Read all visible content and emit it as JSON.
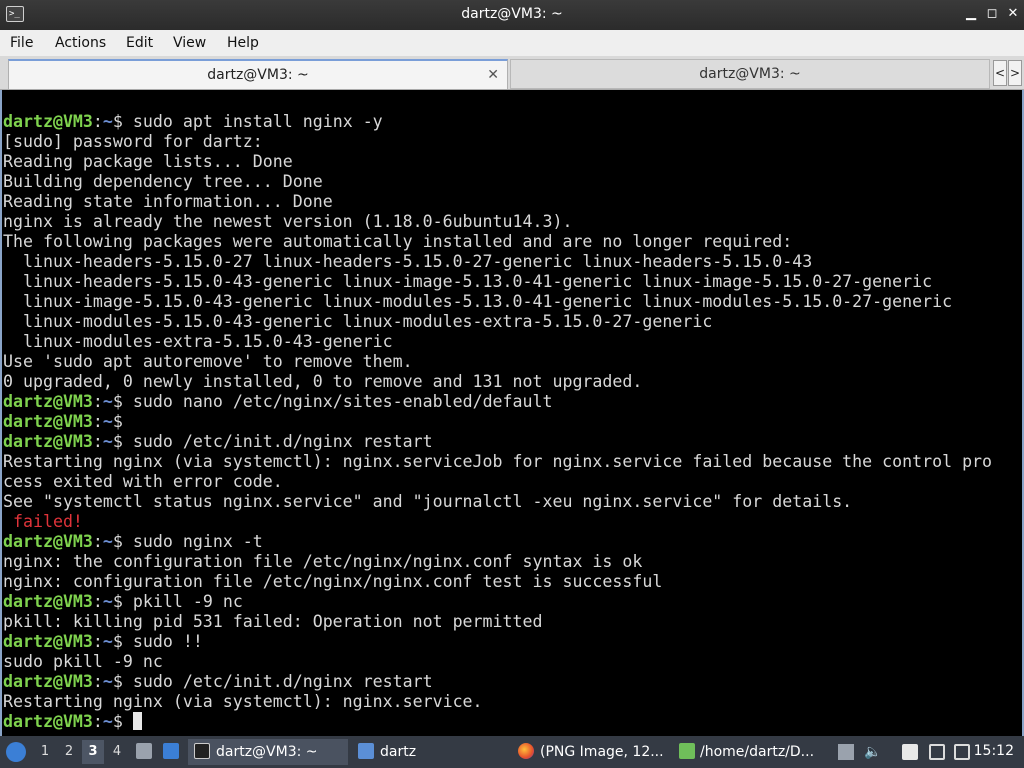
{
  "window": {
    "title": "dartz@VM3: ~",
    "minimize": "▁",
    "maximize": "◻",
    "close": "✕"
  },
  "menu": [
    "File",
    "Actions",
    "Edit",
    "View",
    "Help"
  ],
  "tabs": [
    {
      "label": "dartz@VM3: ~",
      "active": true
    },
    {
      "label": "dartz@VM3: ~",
      "active": false
    }
  ],
  "tab_nav": {
    "prev": "<",
    "next": ">"
  },
  "terminal": {
    "lines": [
      {
        "user": "dartz@VM3",
        "path": "~",
        "cmd": " sudo apt install nginx -y"
      },
      {
        "text": "[sudo] password for dartz:"
      },
      {
        "text": "Reading package lists... Done"
      },
      {
        "text": "Building dependency tree... Done"
      },
      {
        "text": "Reading state information... Done"
      },
      {
        "text": "nginx is already the newest version (1.18.0-6ubuntu14.3)."
      },
      {
        "text": "The following packages were automatically installed and are no longer required:"
      },
      {
        "text": "  linux-headers-5.15.0-27 linux-headers-5.15.0-27-generic linux-headers-5.15.0-43"
      },
      {
        "text": "  linux-headers-5.15.0-43-generic linux-image-5.13.0-41-generic linux-image-5.15.0-27-generic"
      },
      {
        "text": "  linux-image-5.15.0-43-generic linux-modules-5.13.0-41-generic linux-modules-5.15.0-27-generic"
      },
      {
        "text": "  linux-modules-5.15.0-43-generic linux-modules-extra-5.15.0-27-generic"
      },
      {
        "text": "  linux-modules-extra-5.15.0-43-generic"
      },
      {
        "text": "Use 'sudo apt autoremove' to remove them."
      },
      {
        "text": "0 upgraded, 0 newly installed, 0 to remove and 131 not upgraded."
      },
      {
        "user": "dartz@VM3",
        "path": "~",
        "cmd": " sudo nano /etc/nginx/sites-enabled/default"
      },
      {
        "user": "dartz@VM3",
        "path": "~",
        "cmd": ""
      },
      {
        "user": "dartz@VM3",
        "path": "~",
        "cmd": " sudo /etc/init.d/nginx restart"
      },
      {
        "text": "Restarting nginx (via systemctl): nginx.serviceJob for nginx.service failed because the control pro"
      },
      {
        "text": "cess exited with error code."
      },
      {
        "text": "See \"systemctl status nginx.service\" and \"journalctl -xeu nginx.service\" for details."
      },
      {
        "fail": " failed!"
      },
      {
        "user": "dartz@VM3",
        "path": "~",
        "cmd": " sudo nginx -t"
      },
      {
        "text": "nginx: the configuration file /etc/nginx/nginx.conf syntax is ok"
      },
      {
        "text": "nginx: configuration file /etc/nginx/nginx.conf test is successful"
      },
      {
        "user": "dartz@VM3",
        "path": "~",
        "cmd": " pkill -9 nc"
      },
      {
        "text": "pkill: killing pid 531 failed: Operation not permitted"
      },
      {
        "user": "dartz@VM3",
        "path": "~",
        "cmd": " sudo !!"
      },
      {
        "text": "sudo pkill -9 nc"
      },
      {
        "user": "dartz@VM3",
        "path": "~",
        "cmd": " sudo /etc/init.d/nginx restart"
      },
      {
        "text": "Restarting nginx (via systemctl): nginx.service."
      },
      {
        "user": "dartz@VM3",
        "path": "~",
        "cmd": " ",
        "cursor": true
      }
    ]
  },
  "taskbar": {
    "workspaces": [
      "1",
      "2",
      "3",
      "4"
    ],
    "active_workspace": "3",
    "tasks": [
      {
        "label": "dartz@VM3: ~",
        "icon": "terminal-icon"
      },
      {
        "label": "dartz",
        "icon": "folder-icon"
      },
      {
        "label": "(PNG Image, 12...",
        "icon": "firefox-icon"
      },
      {
        "label": "/home/dartz/D...",
        "icon": "text-editor-icon"
      }
    ],
    "clock": "15:12"
  },
  "colors": {
    "prompt_user": "#7fd34e",
    "prompt_path": "#6d8fd4",
    "error": "#e0333a",
    "terminal_bg": "#000000",
    "taskbar_bg": "#343a44"
  }
}
